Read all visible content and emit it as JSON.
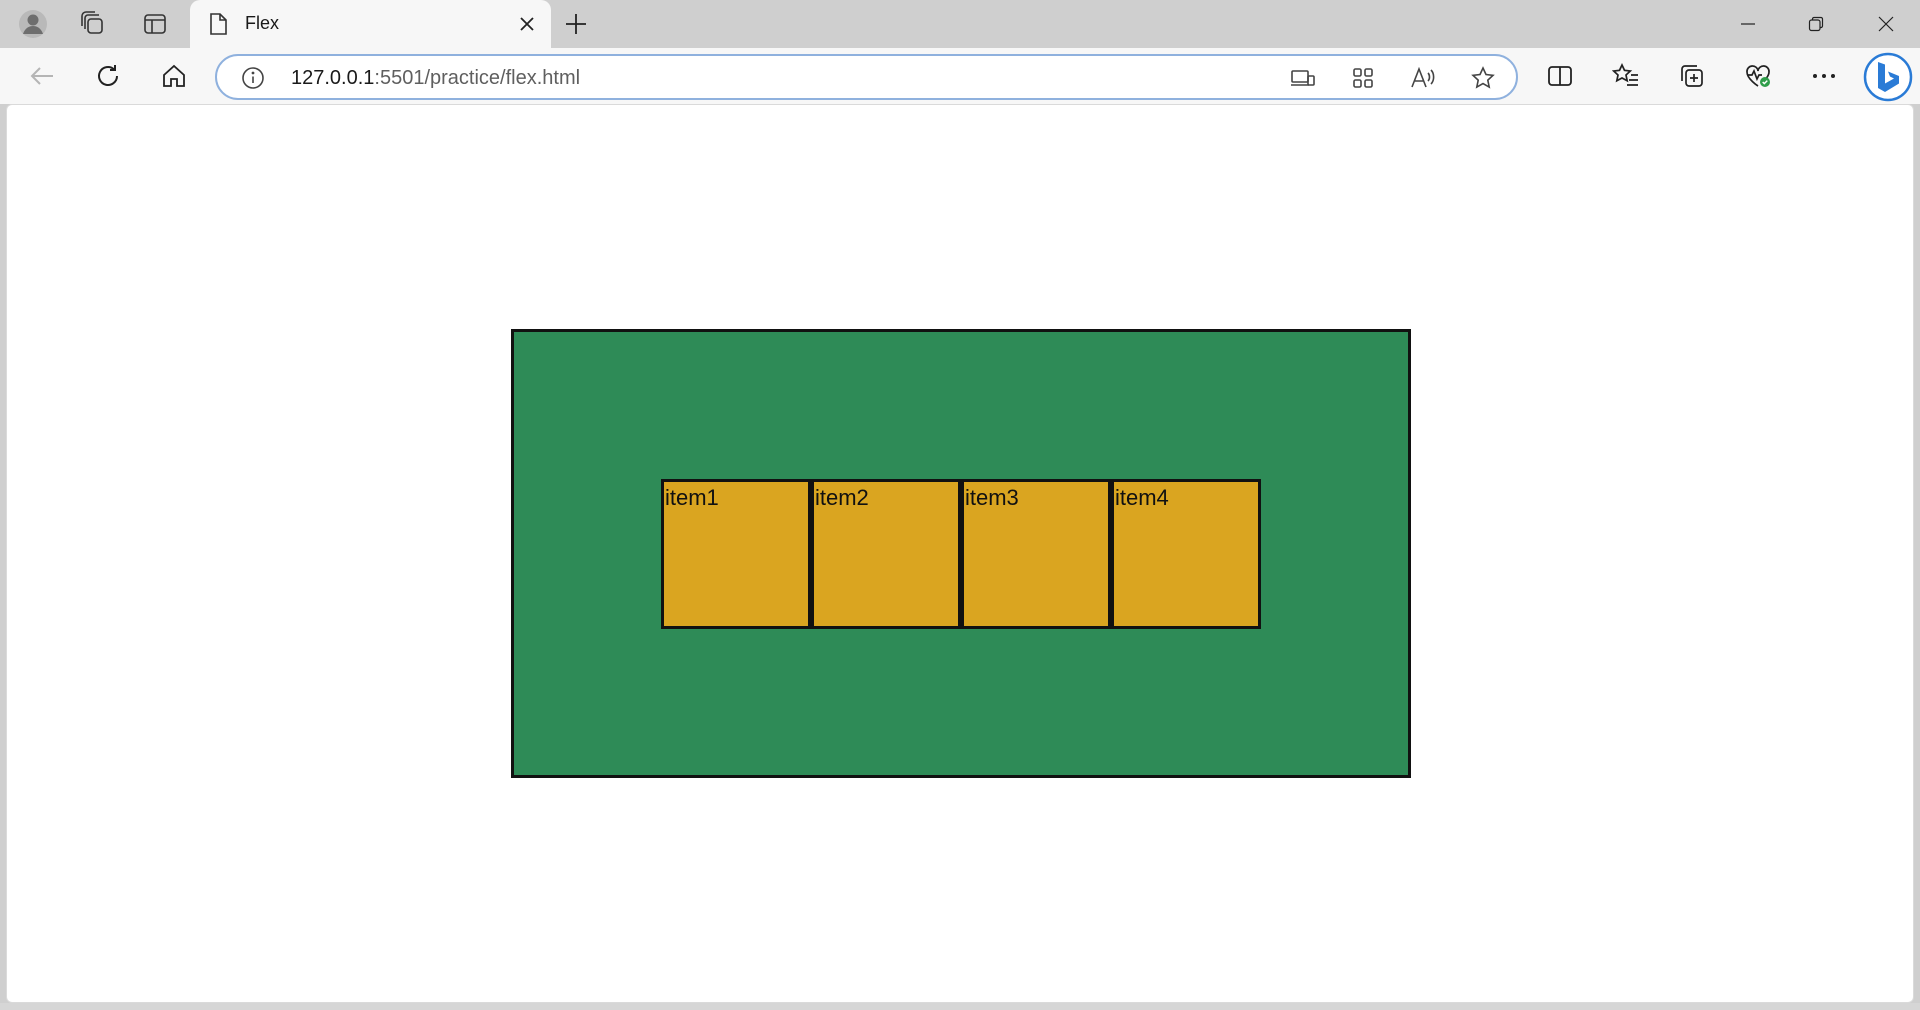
{
  "browser": {
    "tab": {
      "title": "Flex"
    },
    "address": {
      "host": "127.0.0.1",
      "path": ":5501/practice/flex.html"
    }
  },
  "page": {
    "container_color": "#2e8b57",
    "item_color": "#daa520",
    "items": [
      {
        "label": "item1"
      },
      {
        "label": "item2"
      },
      {
        "label": "item3"
      },
      {
        "label": "item4"
      }
    ]
  }
}
